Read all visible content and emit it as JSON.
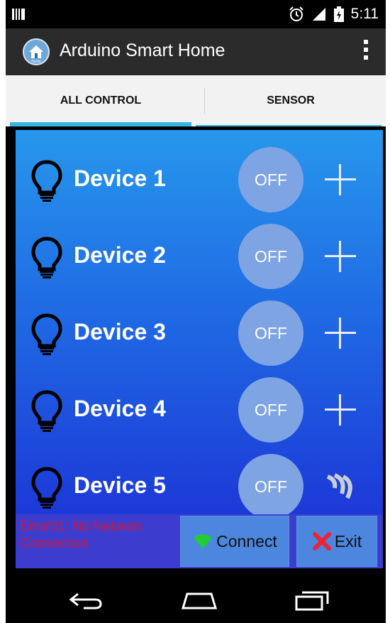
{
  "status_bar": {
    "time": "5:11"
  },
  "app": {
    "title": "Arduino Smart Home",
    "icon_caption": "Home"
  },
  "tabs": [
    {
      "label": "ALL CONTROL",
      "active": true
    },
    {
      "label": "SENSOR",
      "active": false
    }
  ],
  "devices": [
    {
      "name": "Device 1",
      "state": "OFF",
      "action_icon": "plus-icon"
    },
    {
      "name": "Device 2",
      "state": "OFF",
      "action_icon": "plus-icon"
    },
    {
      "name": "Device 3",
      "state": "OFF",
      "action_icon": "plus-icon"
    },
    {
      "name": "Device 4",
      "state": "OFF",
      "action_icon": "plus-icon"
    },
    {
      "name": "Device 5",
      "state": "OFF",
      "action_icon": "sensor-wave-icon"
    }
  ],
  "bottom": {
    "error": "Error01: No Network Connection",
    "connect_label": "Connect",
    "exit_label": "Exit"
  },
  "colors": {
    "accent": "#33b5e5",
    "content_top": "#2797ec",
    "content_bottom": "#1c2cd4",
    "error": "#d3123a",
    "button": "#4d86de",
    "connect_icon": "#22cc33",
    "exit_icon": "#ee2233"
  }
}
